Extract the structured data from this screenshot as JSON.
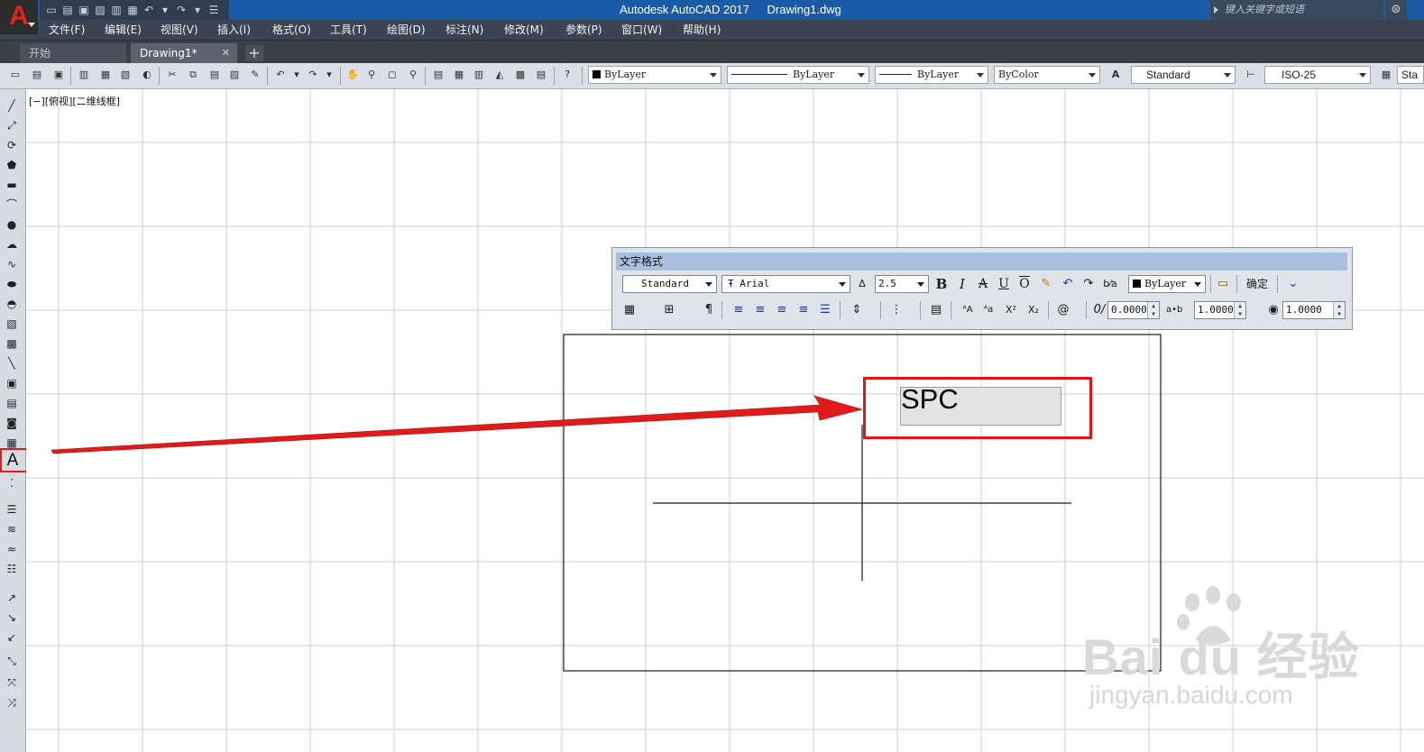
{
  "titlebar": {
    "app_name": "Autodesk AutoCAD 2017",
    "file_name": "Drawing1.dwg",
    "search_placeholder": "键入关键字或短语"
  },
  "menu": {
    "items": [
      "文件(F)",
      "编辑(E)",
      "视图(V)",
      "插入(I)",
      "格式(O)",
      "工具(T)",
      "绘图(D)",
      "标注(N)",
      "修改(M)",
      "参数(P)",
      "窗口(W)",
      "帮助(H)"
    ]
  },
  "tabs": {
    "start": "开始",
    "drawing": "Drawing1*",
    "close": "✕",
    "add": "+"
  },
  "toolbar": {
    "color": "ByLayer",
    "linetype": "ByLayer",
    "lineweight": "ByLayer",
    "plotstyle": "ByColor",
    "text_style": "Standard",
    "dim_style": "ISO-25",
    "table_style_partial": "Sta"
  },
  "viewport": {
    "label": "[−][俯视][二维线框]"
  },
  "text_formatting": {
    "title": "文字格式",
    "style": "Standard",
    "font": "Arial",
    "height": "2.5",
    "bold": "B",
    "italic": "I",
    "strike": "A",
    "underline": "U",
    "overline": "O",
    "color": "ByLayer",
    "ok_button": "确定",
    "oblique": "0.0000",
    "tracking": "1.0000",
    "width_factor": "1.0000"
  },
  "drawing": {
    "mtext": "SPC"
  },
  "watermark": {
    "logo": "Bai du 经验",
    "url": "jingyan.baidu.com"
  },
  "colors": {
    "titlebar": "#1a5ba8",
    "menubar": "#3b4453",
    "highlight": "#e21414",
    "panel_title": "#a8bfde"
  }
}
